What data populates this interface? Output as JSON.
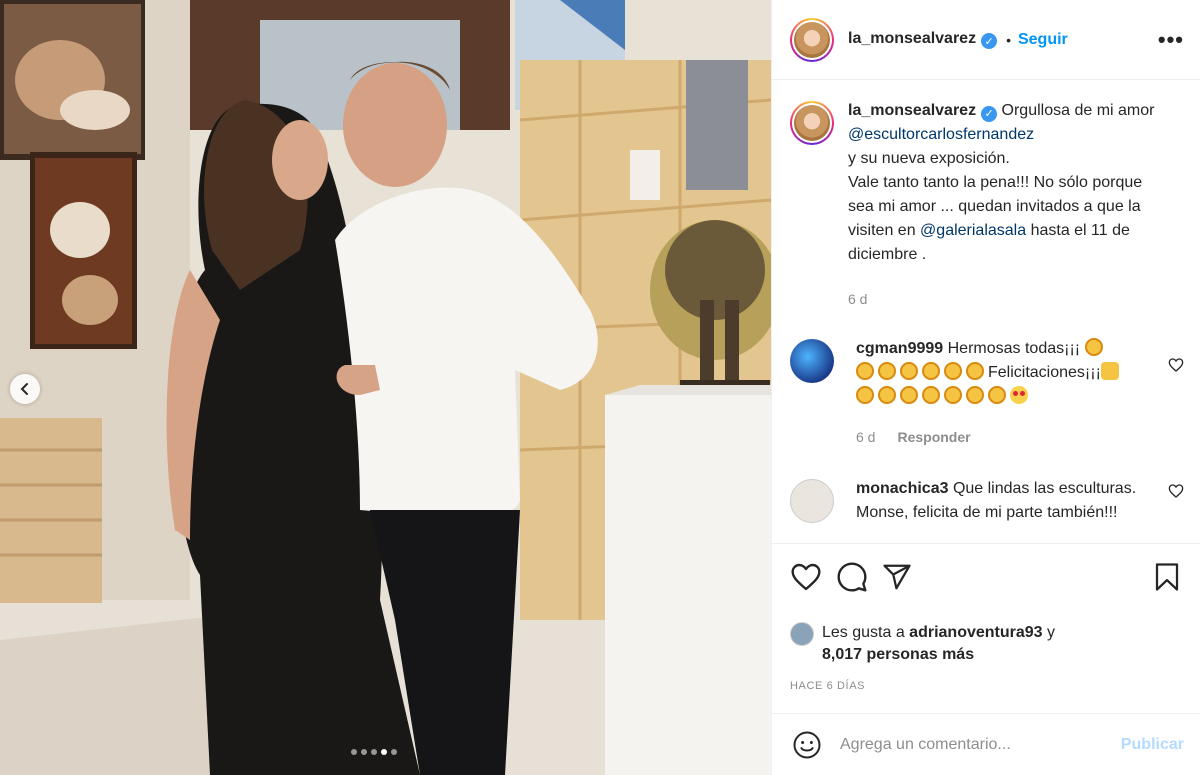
{
  "post": {
    "username": "la_monsealvarez",
    "separator": "•",
    "follow_label": "Seguir",
    "more_label": "•••",
    "carousel": {
      "total_dots": 5,
      "active_index": 3
    }
  },
  "caption": {
    "username": "la_monsealvarez",
    "text_1": "Orgullosa de mi amor ",
    "mention_1": "@escultorcarlosfernandez",
    "text_2": "y su nueva exposición.",
    "text_3": "Vale tanto tanto la pena!!! No sólo porque sea mi amor ... quedan invitados a que la visiten en ",
    "mention_2": "@galerialasala",
    "text_4": " hasta el 11 de diciembre .",
    "time": "6 d"
  },
  "comments": [
    {
      "username": "cgman9999",
      "text_1": "Hermosas todas¡¡¡ ",
      "text_2": "Felicitaciones¡¡¡",
      "time": "6 d",
      "reply_label": "Responder"
    },
    {
      "username": "monachica3",
      "text": "Que lindas las esculturas. Monse, felicita de mi parte también!!!"
    }
  ],
  "likes": {
    "prefix": "Les gusta a ",
    "user": "adrianoventura93",
    "joiner": " y",
    "count_text": "8,017 personas más"
  },
  "timestamp": "HACE 6 DÍAS",
  "comment_box": {
    "placeholder": "Agrega un comentario...",
    "publish_label": "Publicar"
  },
  "colors": {
    "accent": "#0095f6",
    "verified": "#3897f0",
    "mention": "#00376b",
    "muted": "#8e8e8e",
    "publish_disabled": "#b3dbff"
  },
  "icons": [
    "chevron-left-icon",
    "verified-icon",
    "heart-icon",
    "comment-icon",
    "share-icon",
    "bookmark-icon",
    "smile-icon"
  ]
}
